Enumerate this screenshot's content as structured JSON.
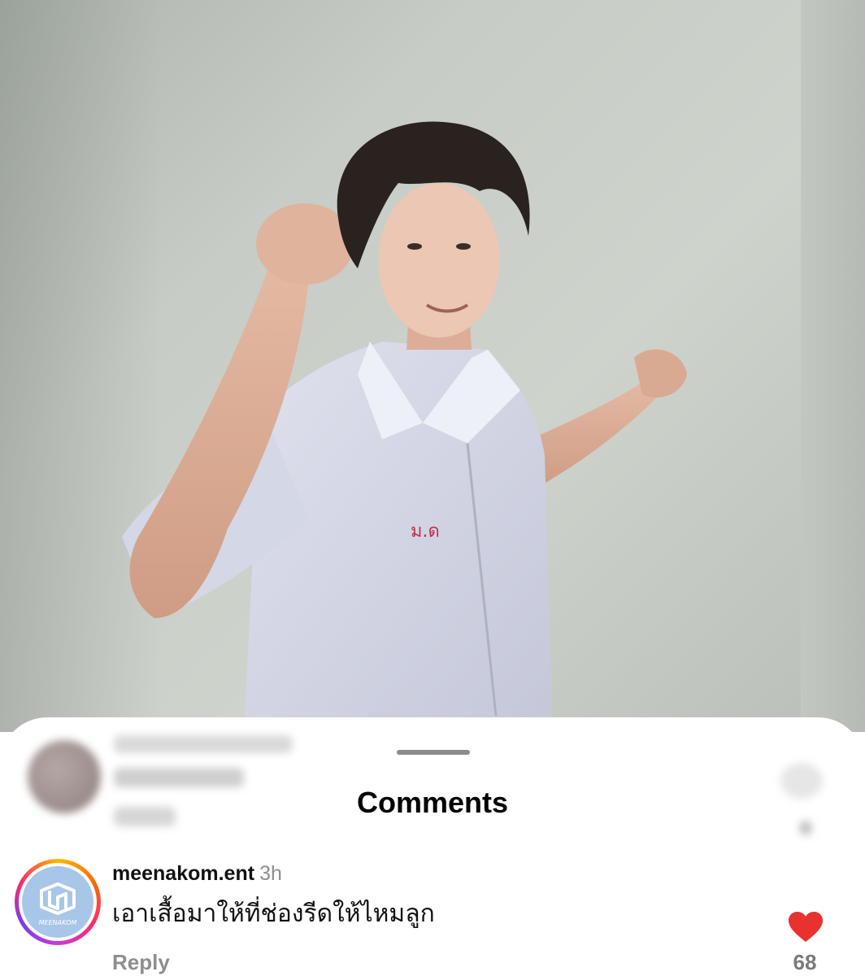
{
  "video": {
    "description_icon": "video-frame"
  },
  "sheet": {
    "title": "Comments",
    "comment": {
      "username": "meenakom.ent",
      "time": "3h",
      "text": "เอาเสื้อมาให้ที่ช่องรีดให้ไหมลูก",
      "reply_label": "Reply",
      "like_count": "68",
      "liked": true,
      "avatar_logo": "MEENAKOM"
    }
  },
  "colors": {
    "heart": "#e8322f",
    "muted_text": "#8e8e8e",
    "avatar_bg": "#a8c6e8"
  }
}
